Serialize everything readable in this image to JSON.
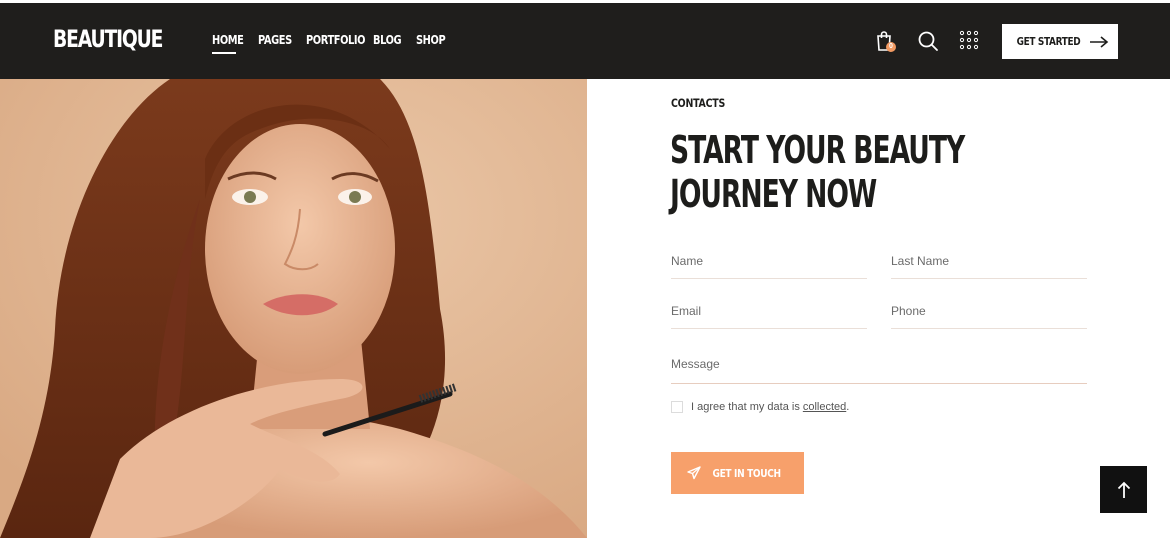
{
  "brand": {
    "logo": "BEAUTIQUE"
  },
  "nav": {
    "items": [
      {
        "label": "HOME",
        "active": true
      },
      {
        "label": "PAGES"
      },
      {
        "label": "PORTFOLIO"
      },
      {
        "label": "BLOG"
      },
      {
        "label": "SHOP"
      }
    ]
  },
  "header_icons": {
    "cart": {
      "icon": "shopping-bag-icon",
      "badge": "0"
    },
    "search": {
      "icon": "search-icon"
    },
    "menu": {
      "icon": "dots-grid-icon"
    }
  },
  "cta": {
    "label": "GET STARTED",
    "icon": "arrow-right-icon"
  },
  "hero_image": {
    "alt": "woman-holding-mascara-wand"
  },
  "contact": {
    "eyebrow": "CONTACTS",
    "headline_line1": "START YOUR BEAUTY",
    "headline_line2": "JOURNEY NOW",
    "fields": {
      "name_placeholder": "Name",
      "last_name_placeholder": "Last Name",
      "email_placeholder": "Email",
      "phone_placeholder": "Phone",
      "message_placeholder": "Message"
    },
    "consent_text": "I agree that my data is",
    "consent_link": "collected",
    "consent_period": ".",
    "submit_label": "GET IN TOUCH",
    "submit_icon": "paper-plane-icon"
  },
  "back_to_top": {
    "icon": "arrow-up-icon"
  },
  "colors": {
    "header_bg": "#1f1e1c",
    "accent": "#f7a06b",
    "photo_bg": "#e5b895"
  }
}
